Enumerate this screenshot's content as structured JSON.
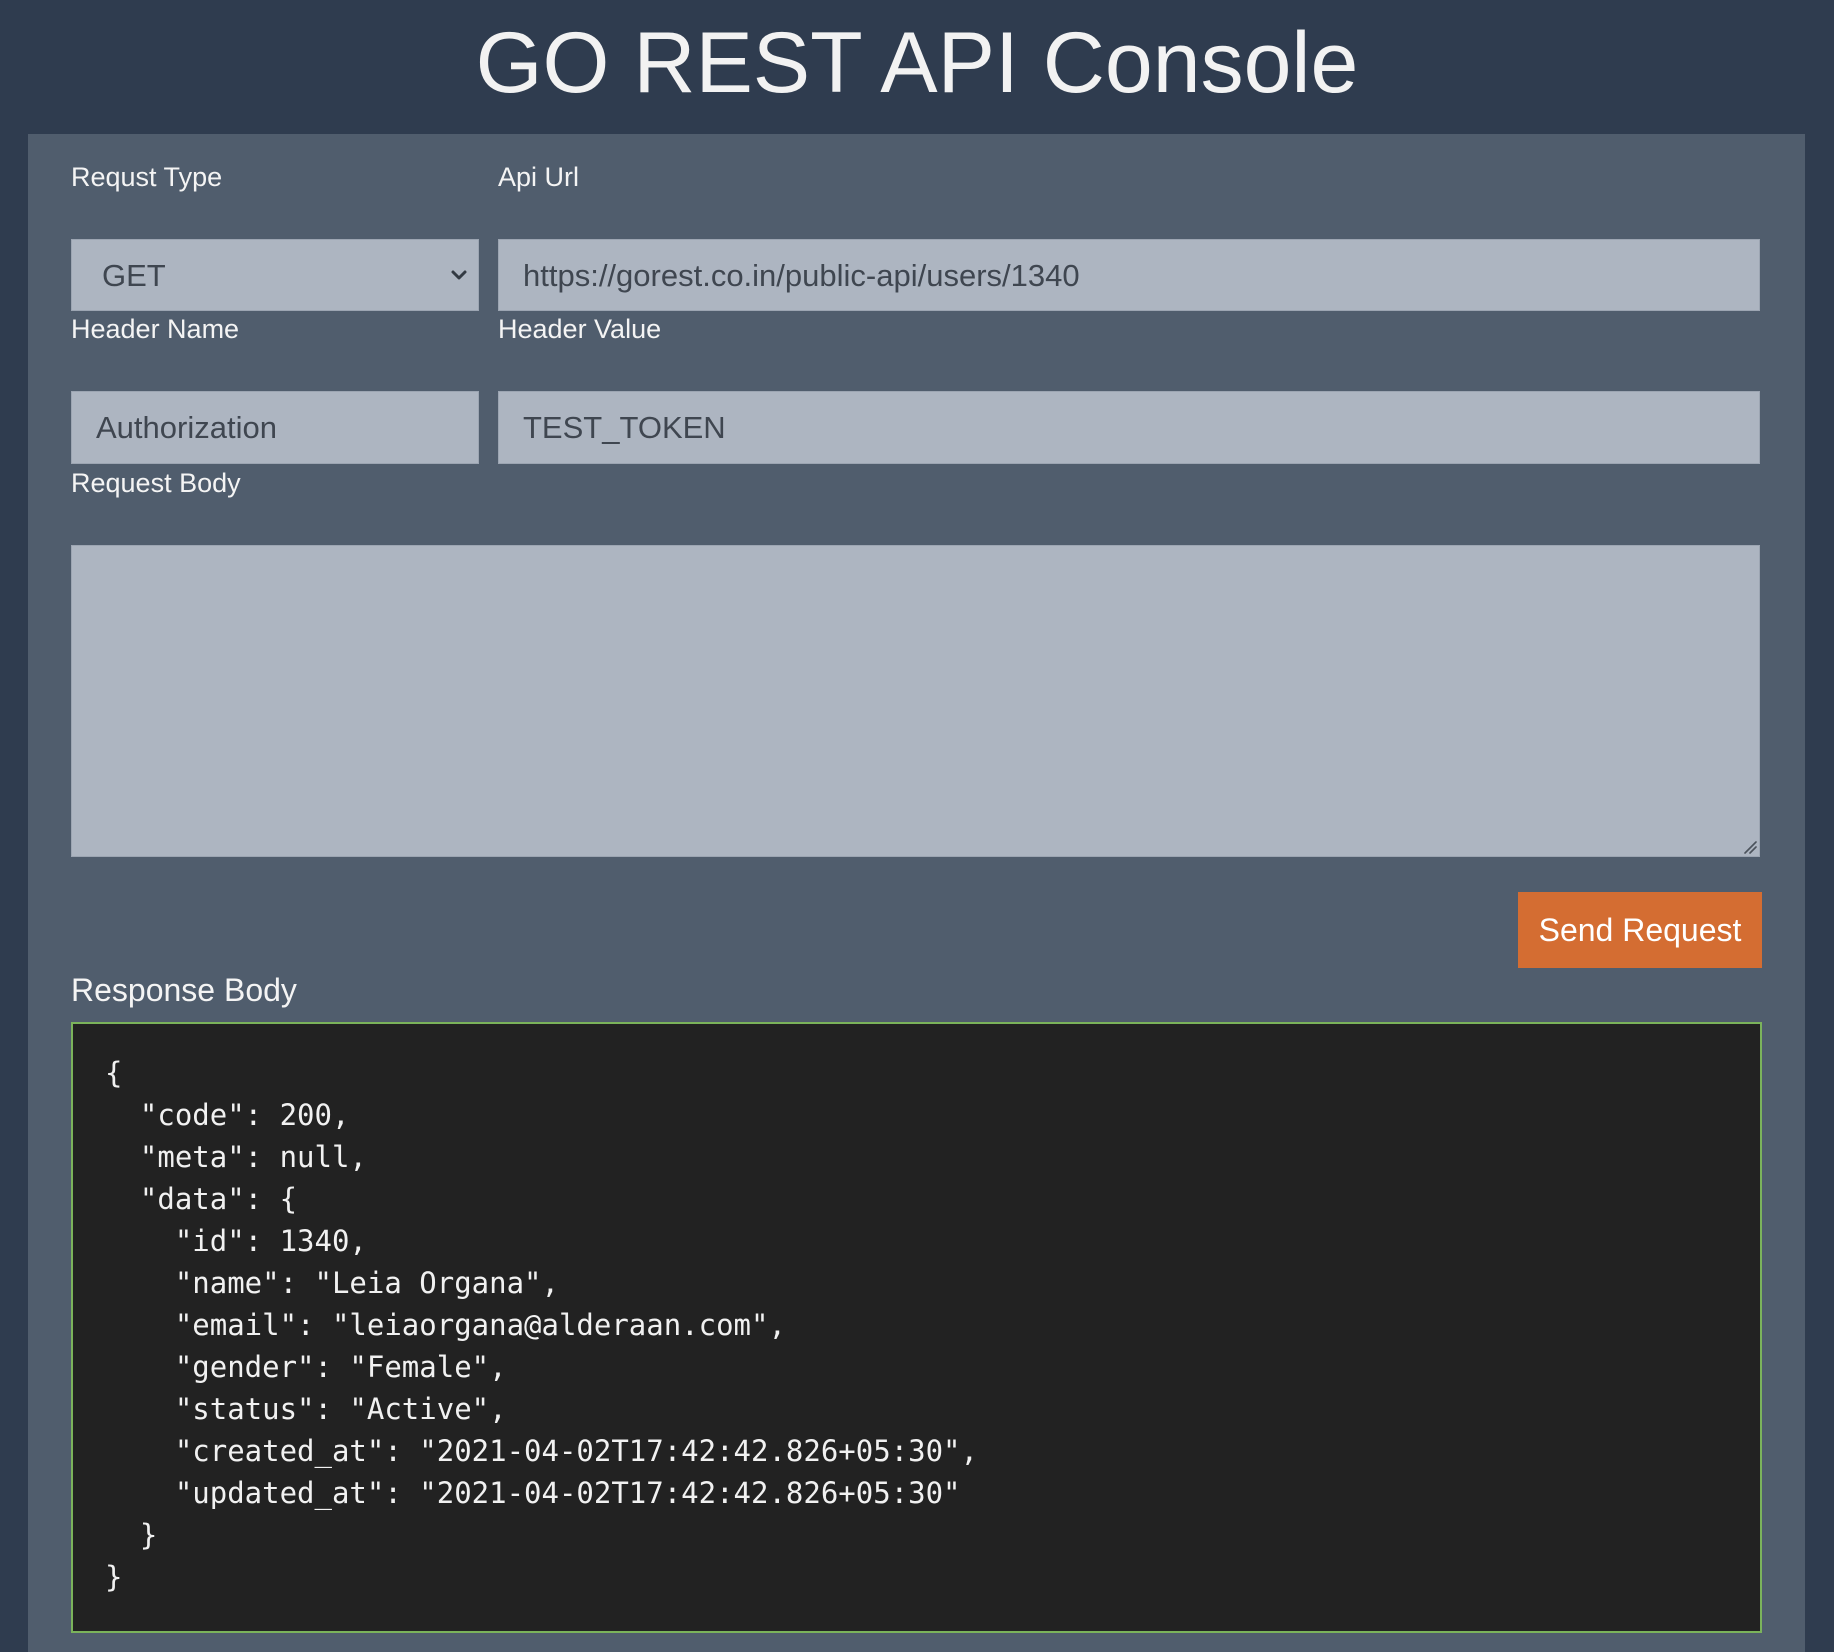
{
  "header": {
    "title": "GO REST API Console"
  },
  "form": {
    "request_type": {
      "label": "Requst Type",
      "selected": "GET"
    },
    "api_url": {
      "label": "Api Url",
      "value": "https://gorest.co.in/public-api/users/1340"
    },
    "header_name": {
      "label": "Header Name",
      "value": "Authorization"
    },
    "header_value": {
      "label": "Header Value",
      "value": "TEST_TOKEN"
    },
    "request_body": {
      "label": "Request Body",
      "value": ""
    },
    "send_button_label": "Send Request"
  },
  "response": {
    "label": "Response Body",
    "body": "{\n  \"code\": 200,\n  \"meta\": null,\n  \"data\": {\n    \"id\": 1340,\n    \"name\": \"Leia Organa\",\n    \"email\": \"leiaorgana@alderaan.com\",\n    \"gender\": \"Female\",\n    \"status\": \"Active\",\n    \"created_at\": \"2021-04-02T17:42:42.826+05:30\",\n    \"updated_at\": \"2021-04-02T17:42:42.826+05:30\"\n  }\n}"
  },
  "colors": {
    "page_background": "#2f3c4f",
    "panel_background": "#505d6d",
    "field_background": "#adb5c1",
    "button_background": "#d46d32",
    "response_background": "#222222",
    "response_border": "#7bb35b"
  },
  "icons": {
    "select_arrow": "chevron-down-icon",
    "textarea_resize": "resize-handle-icon"
  }
}
